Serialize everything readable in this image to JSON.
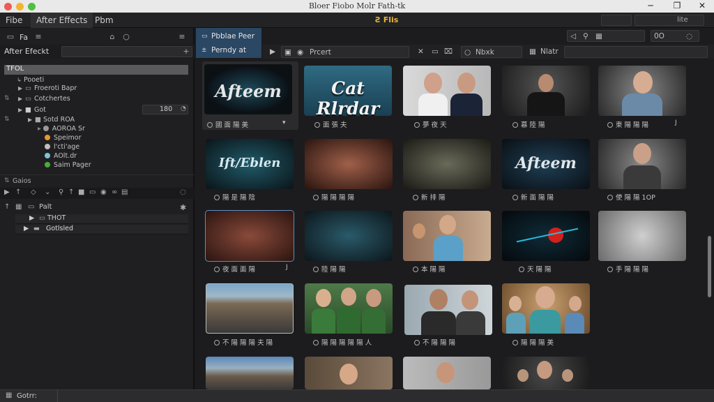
{
  "window": {
    "title": "Bloer Fiobo Molr Fath-tk",
    "controls": {
      "minimize": "─",
      "maximize": "❐",
      "close": "✕"
    }
  },
  "menubar": {
    "items": [
      "Fibe",
      "After Effects",
      "Pbm"
    ],
    "app_badge": "Ƨ Flis"
  },
  "left_panel": {
    "header_label": "Fa",
    "search_title": "After Efeckt",
    "selected_item": "TFOL",
    "tree": [
      {
        "label": "Pooeti",
        "indent": 1
      },
      {
        "label": "Froeroti Bapr",
        "indent": 1,
        "expand": "▶"
      },
      {
        "label": "Cotchertes",
        "indent": 1,
        "expand": "▶"
      },
      {
        "label": "Got",
        "indent": 1,
        "expand": "▶",
        "value": "180"
      },
      {
        "label": "Sotd ROA",
        "indent": 2
      },
      {
        "label": "AOROA Sr",
        "indent": 2,
        "dot": "#9a9a9a"
      },
      {
        "label": "Speimor",
        "indent": 2,
        "dot": "#e8962e"
      },
      {
        "label": "l'cti'age",
        "indent": 2,
        "dot": "#bfbfbf"
      },
      {
        "label": "AOlt.dr",
        "indent": 2,
        "dot": "#7ec3e0"
      },
      {
        "label": "Saim Pager",
        "indent": 2,
        "dot": "#4caa3a"
      }
    ],
    "section_label": "Gaios",
    "layers_header": "Palt",
    "layers": [
      "THOT",
      "Gotlsled"
    ]
  },
  "content": {
    "active_tab": {
      "line1": "Pbblae Peer",
      "line2": "Perndy at"
    },
    "toolbar_labels": {
      "preset": "Prcert",
      "mode": "Nbxk",
      "mode2": "Nlatr"
    },
    "items": [
      {
        "caption": "國 面 陽 美",
        "title": "Afteem",
        "mark": "▾"
      },
      {
        "caption": "面 張 夫",
        "title": "Cat Rlrdar"
      },
      {
        "caption": "夢 夜 天",
        "title": ""
      },
      {
        "caption": "慕 陸 陽",
        "title": ""
      },
      {
        "caption": "東 陽 陽 陽",
        "title": "",
        "mark": "J"
      },
      {
        "caption": "陽 是 陽 陰",
        "title": "Ift/Eblen"
      },
      {
        "caption": "陽 陽 陽 陽",
        "title": ""
      },
      {
        "caption": "新 排 陽",
        "title": ""
      },
      {
        "caption": "新 面 陽 陽",
        "title": "Afteem"
      },
      {
        "caption": "使 陽 陽 1OP",
        "title": ""
      },
      {
        "caption": "夜 面 面 陽",
        "title": "",
        "mark": "J"
      },
      {
        "caption": "陸 陽 陽",
        "title": ""
      },
      {
        "caption": "本 陽 陽",
        "title": ""
      },
      {
        "caption": "天 陽 陽",
        "title": ""
      },
      {
        "caption": "手 陽 陽 陽",
        "title": ""
      },
      {
        "caption": "不 陽 陽 陽 夫 陽",
        "title": ""
      },
      {
        "caption": "陽 陽 陽 陽 陽 人",
        "title": ""
      },
      {
        "caption": "不 陽 陽 陽",
        "title": ""
      },
      {
        "caption": "陽 陽 陽 美",
        "title": ""
      }
    ]
  },
  "statusbar": {
    "text": "Gotrr:"
  }
}
